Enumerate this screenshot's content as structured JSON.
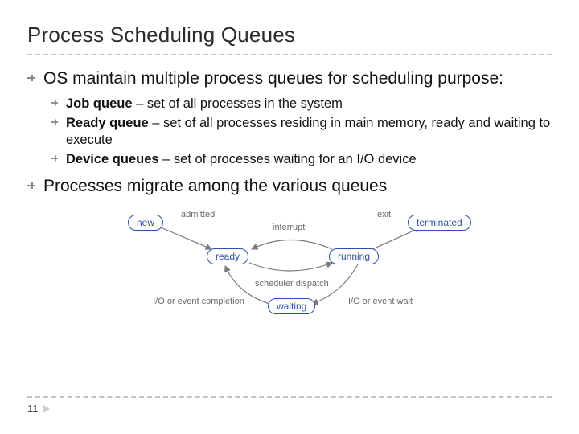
{
  "title": "Process Scheduling Queues",
  "points": {
    "p1": "OS maintain multiple process queues for scheduling purpose:",
    "p2": "Processes migrate among the various queues"
  },
  "subs": {
    "s1_bold": "Job queue",
    "s1_rest": " – set of all processes in the system",
    "s2_bold": "Ready queue",
    "s2_rest": " – set of all processes residing in main memory, ready and waiting to execute",
    "s3_bold": "Device queues",
    "s3_rest": " – set of processes waiting for an I/O device"
  },
  "diagram": {
    "nodes": {
      "new": "new",
      "ready": "ready",
      "running": "running",
      "terminated": "terminated",
      "waiting": "waiting"
    },
    "labels": {
      "admitted": "admitted",
      "interrupt": "interrupt",
      "exit": "exit",
      "dispatch": "scheduler dispatch",
      "io_done": "I/O or event completion",
      "io_wait": "I/O or event wait"
    }
  },
  "page": "11"
}
